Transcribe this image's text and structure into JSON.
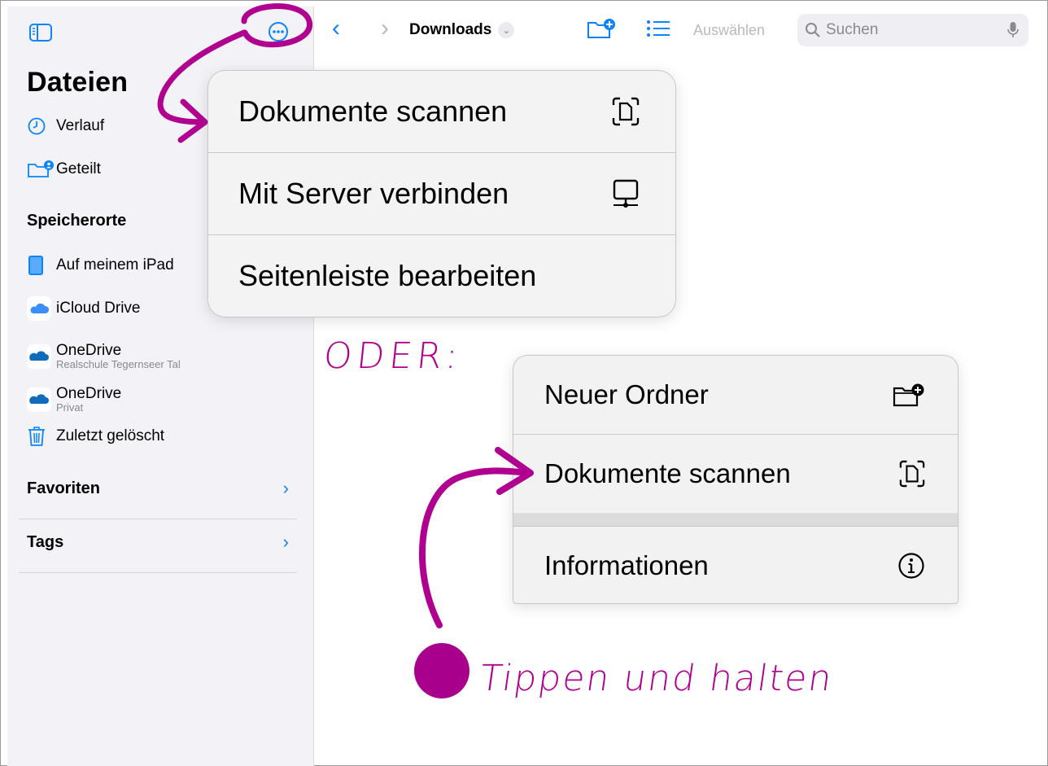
{
  "sidebar": {
    "title": "Dateien",
    "recent": "Verlauf",
    "shared": "Geteilt",
    "locations_header": "Speicherorte",
    "locations": [
      {
        "label": "Auf meinem iPad",
        "sub": ""
      },
      {
        "label": "iCloud Drive",
        "sub": ""
      },
      {
        "label": "OneDrive",
        "sub": "Realschule Tegernseer Tal"
      },
      {
        "label": "OneDrive",
        "sub": "Privat"
      },
      {
        "label": "Zuletzt gelöscht",
        "sub": ""
      }
    ],
    "favorites": "Favoriten",
    "tags": "Tags"
  },
  "toolbar": {
    "folder_title": "Downloads",
    "select_label": "Auswählen",
    "search_placeholder": "Suchen",
    "accent_color": "#0a84ff"
  },
  "menu_top": {
    "items": [
      {
        "label": "Dokumente scannen",
        "icon": "scan-document-icon"
      },
      {
        "label": "Mit Server verbinden",
        "icon": "server-icon"
      },
      {
        "label": "Seitenleiste bearbeiten",
        "icon": ""
      }
    ]
  },
  "menu_bottom": {
    "items": [
      {
        "label": "Neuer Ordner",
        "icon": "new-folder-icon"
      },
      {
        "label": "Dokumente scannen",
        "icon": "scan-document-icon"
      },
      {
        "label": "Informationen",
        "icon": "info-icon"
      }
    ]
  },
  "annotations": {
    "oder": "ODER:",
    "tippen": "Tippen und halten",
    "color": "#b0008f"
  }
}
